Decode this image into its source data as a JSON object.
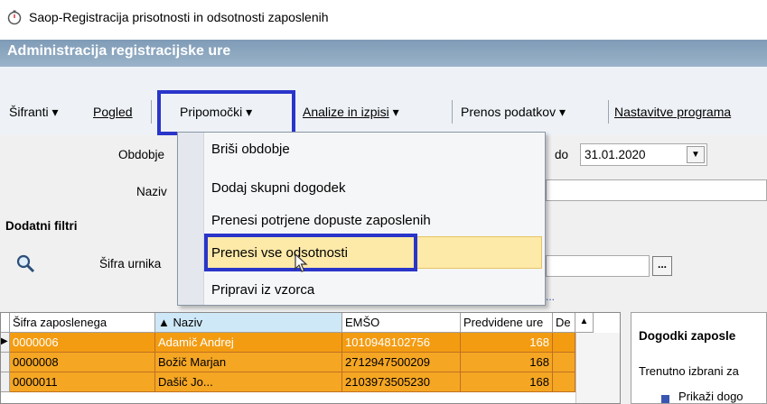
{
  "window": {
    "title": "Saop-Registracija prisotnosti in odsotnosti zaposlenih"
  },
  "header": {
    "title": "Administracija registracijske ure"
  },
  "menu": {
    "items": [
      {
        "label": "Šifranti",
        "arrow": "▾"
      },
      {
        "label": "Pogled",
        "arrow": ""
      },
      {
        "label": "Pripomočki",
        "arrow": "▾"
      },
      {
        "label": "Analize in izpisi",
        "arrow": "▾"
      },
      {
        "label": "Prenos podatkov",
        "arrow": "▾"
      },
      {
        "label": "Nastavitve programa",
        "arrow": ""
      }
    ]
  },
  "dropdown": {
    "items": [
      {
        "label": "Briši obdobje"
      },
      {
        "label": "Dodaj skupni dogodek"
      },
      {
        "label": "Prenesi potrjene dopuste zaposlenih"
      },
      {
        "label": "Prenesi vse odsotnosti"
      },
      {
        "label": "Pripravi iz vzorca"
      }
    ],
    "highlight_color": "#fde9a8"
  },
  "filters": {
    "obdobje_label": "Obdobje",
    "naziv_label": "Naziv",
    "do_label": "do",
    "do_value": "31.01.2020",
    "dodatni_label": "Dodatni filtri",
    "sifra_urnika_label": "Šifra urnika",
    "more": "..."
  },
  "grid": {
    "columns": [
      "Šifra zaposlenega",
      "▲ Naziv",
      "EMŠO",
      "Predvidene ure",
      "De"
    ],
    "rows": [
      {
        "sifra": "0000006",
        "naziv": "Adamič Andrej",
        "emso": "1010948102756",
        "ure": "168",
        "selected": true
      },
      {
        "sifra": "0000008",
        "naziv": "Božič Marjan",
        "emso": "2712947500209",
        "ure": "168",
        "selected": false
      },
      {
        "sifra": "0000011",
        "naziv": "Dašič Jo...",
        "emso": "2103973505230",
        "ure": "168",
        "selected": false
      }
    ],
    "row_color": "#f5a623"
  },
  "right_panel": {
    "title": "Dogodki zaposle",
    "text": "Trenutno izbrani za",
    "item": "Prikaži dogo"
  },
  "colors": {
    "annotation_box": "#2a35c9",
    "header": "#8ea7be"
  }
}
